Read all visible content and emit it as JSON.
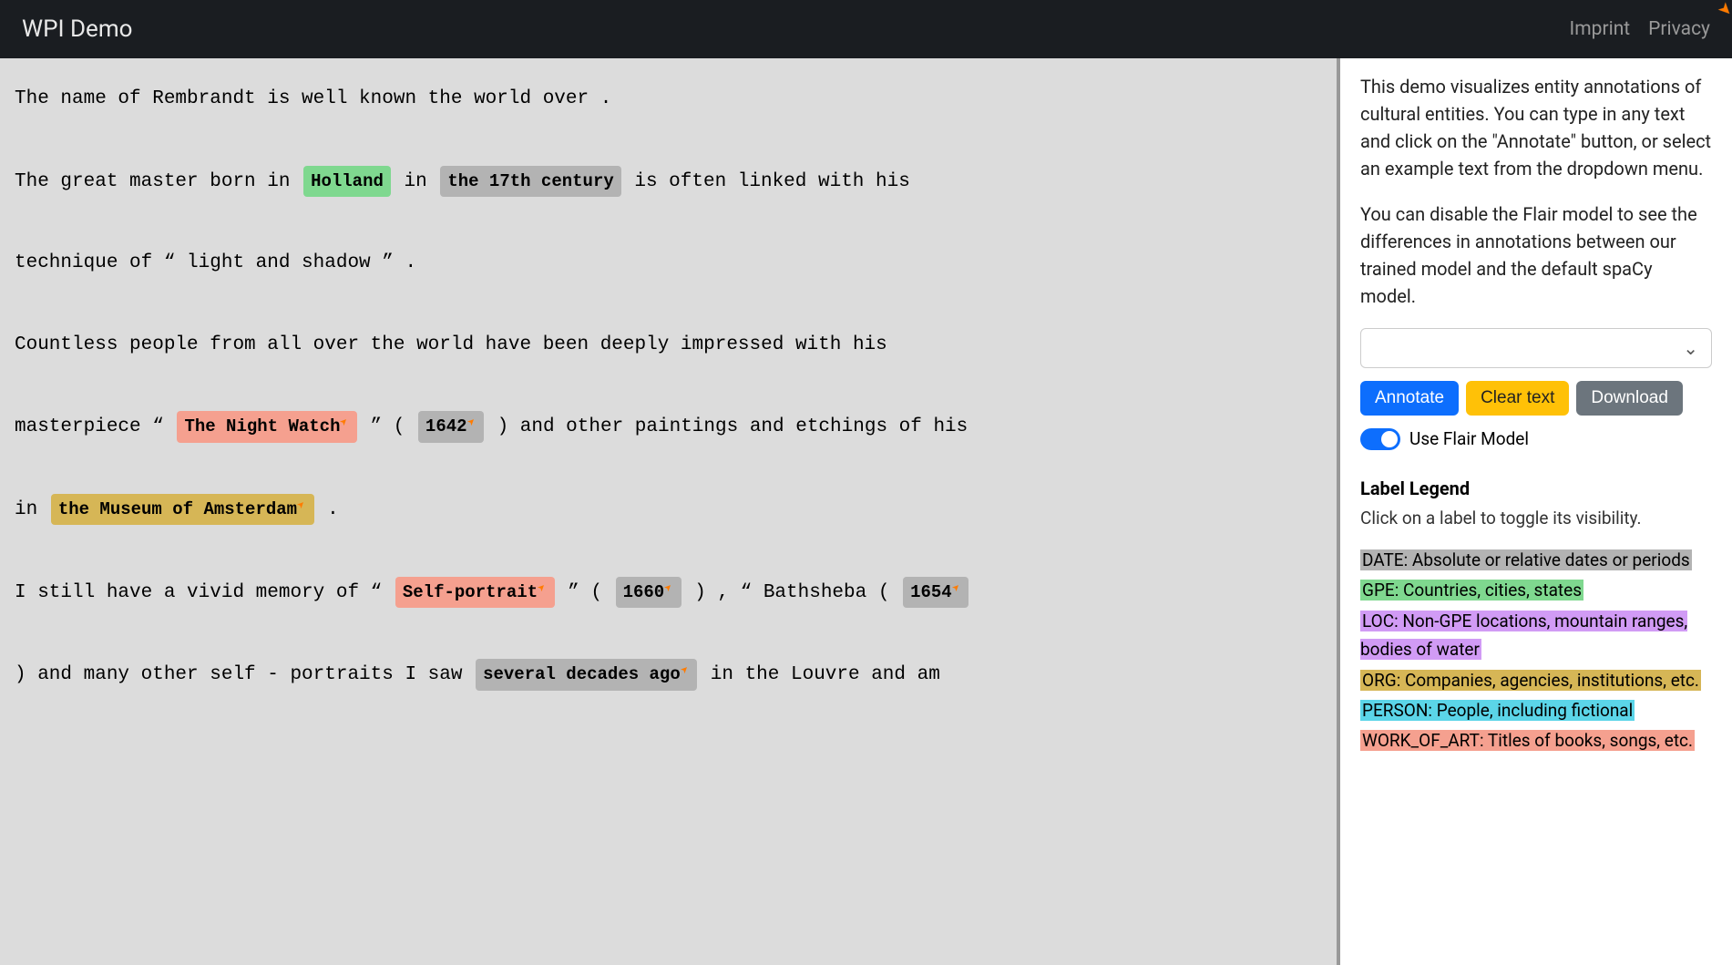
{
  "nav": {
    "brand": "WPI Demo",
    "imprint": "Imprint",
    "privacy": "Privacy"
  },
  "content": {
    "tokens": [
      {
        "type": "line_start"
      },
      {
        "type": "text",
        "value": "The name of Rembrandt is well known the world over ."
      },
      {
        "type": "line_end"
      },
      {
        "type": "line_start"
      },
      {
        "type": "text",
        "value": "The great master born in "
      },
      {
        "type": "entity",
        "label": "GPE",
        "css": "gpe",
        "value": "Holland",
        "arrow": false
      },
      {
        "type": "text",
        "value": " in "
      },
      {
        "type": "entity",
        "label": "DATE",
        "css": "date-bg",
        "value": "the 17th century",
        "arrow": false
      },
      {
        "type": "text",
        "value": " is often linked with his"
      },
      {
        "type": "line_end"
      },
      {
        "type": "line_start"
      },
      {
        "type": "text",
        "value": "technique of “ light and shadow ” ."
      },
      {
        "type": "line_end"
      },
      {
        "type": "line_start"
      },
      {
        "type": "text",
        "value": "Countless people from all over the world have been deeply impressed with his"
      },
      {
        "type": "line_end"
      },
      {
        "type": "line_start"
      },
      {
        "type": "text",
        "value": "masterpiece “ "
      },
      {
        "type": "entity",
        "label": "WORK_OF_ART",
        "css": "woa",
        "value": "The Night Watch",
        "arrow": true
      },
      {
        "type": "text",
        "value": " ” ( "
      },
      {
        "type": "entity",
        "label": "DATE",
        "css": "date-bg",
        "value": "1642",
        "arrow": true
      },
      {
        "type": "text",
        "value": " ) and other paintings and etchings of his"
      },
      {
        "type": "line_end"
      },
      {
        "type": "line_start"
      },
      {
        "type": "text",
        "value": "in "
      },
      {
        "type": "entity",
        "label": "ORG",
        "css": "org",
        "value": "the Museum of Amsterdam",
        "arrow": true
      },
      {
        "type": "text",
        "value": " ."
      },
      {
        "type": "line_end"
      },
      {
        "type": "line_start"
      },
      {
        "type": "text",
        "value": "I still have a vivid memory of “ "
      },
      {
        "type": "entity",
        "label": "WORK_OF_ART",
        "css": "woa",
        "value": "Self-portrait",
        "arrow": true
      },
      {
        "type": "text",
        "value": " ” ( "
      },
      {
        "type": "entity",
        "label": "DATE",
        "css": "date-bg",
        "value": "1660",
        "arrow": true
      },
      {
        "type": "text",
        "value": " ) , “ Bathsheba ( "
      },
      {
        "type": "entity",
        "label": "DATE",
        "css": "date-bg",
        "value": "1654",
        "arrow": true
      },
      {
        "type": "line_end"
      },
      {
        "type": "line_start"
      },
      {
        "type": "text",
        "value": ") and many other self - portraits I saw "
      },
      {
        "type": "entity",
        "label": "DATE",
        "css": "date-bg",
        "value": "several decades ago",
        "arrow": true
      },
      {
        "type": "text",
        "value": " in the Louvre and am"
      },
      {
        "type": "line_end"
      }
    ]
  },
  "sidebar": {
    "para1": "This demo visualizes entity annotations of cultural entities. You can type in any text and click on the \"Annotate\" button, or select an example text from the dropdown menu.",
    "para2": "You can disable the Flair model to see the differences in annotations between our trained model and the default spaCy model.",
    "annotate_label": "Annotate",
    "clear_label": "Clear text",
    "download_label": "Download",
    "toggle_label": "Use Flair Model",
    "toggle_state": true,
    "legend_title": "Label Legend",
    "legend_sub": "Click on a label to toggle its visibility.",
    "legend": [
      {
        "css": "lg-date",
        "text": "DATE: Absolute or relative dates or periods"
      },
      {
        "css": "lg-gpe",
        "text": "GPE: Countries, cities, states"
      },
      {
        "css": "lg-loc",
        "text": "LOC: Non-GPE locations, mountain ranges, bodies of water"
      },
      {
        "css": "lg-org",
        "text": "ORG: Companies, agencies, institutions, etc."
      },
      {
        "css": "lg-person",
        "text": "PERSON: People, including fictional"
      },
      {
        "css": "lg-woa",
        "text": "WORK_OF_ART: Titles of books, songs, etc."
      }
    ]
  },
  "arrow_glyph": "↗"
}
